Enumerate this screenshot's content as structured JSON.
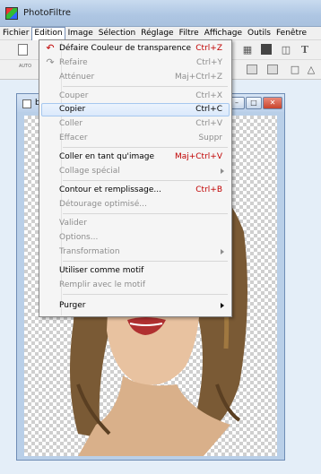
{
  "app": {
    "title": "PhotoFiltre"
  },
  "menubar": [
    "Fichier",
    "Edition",
    "Image",
    "Sélection",
    "Réglage",
    "Filtre",
    "Affichage",
    "Outils",
    "Fenêtre"
  ],
  "toolbar": {
    "small_label": "AUTO"
  },
  "docwin": {
    "title": "b"
  },
  "menu": {
    "items": [
      {
        "label": "Défaire Couleur de transparence",
        "shortcut": "Ctrl+Z",
        "enabled": true,
        "icon": "undo-icon"
      },
      {
        "label": "Refaire",
        "shortcut": "Ctrl+Y",
        "enabled": false,
        "icon": "redo-icon"
      },
      {
        "label": "Atténuer",
        "shortcut": "Maj+Ctrl+Z",
        "enabled": false
      },
      {
        "label": "Couper",
        "shortcut": "Ctrl+X",
        "enabled": false
      },
      {
        "label": "Copier",
        "shortcut": "Ctrl+C",
        "enabled": true,
        "highlighted": true
      },
      {
        "label": "Coller",
        "shortcut": "Ctrl+V",
        "enabled": false
      },
      {
        "label": "Effacer",
        "shortcut": "Suppr",
        "enabled": false
      },
      {
        "label": "Coller en tant qu'image",
        "shortcut": "Maj+Ctrl+V",
        "enabled": true
      },
      {
        "label": "Collage spécial",
        "shortcut": "",
        "enabled": false,
        "submenu": true
      },
      {
        "label": "Contour et remplissage...",
        "shortcut": "Ctrl+B",
        "enabled": true
      },
      {
        "label": "Détourage optimisé...",
        "shortcut": "",
        "enabled": false
      },
      {
        "label": "Valider",
        "shortcut": "",
        "enabled": false
      },
      {
        "label": "Options...",
        "shortcut": "",
        "enabled": false
      },
      {
        "label": "Transformation",
        "shortcut": "",
        "enabled": false,
        "submenu": true
      },
      {
        "label": "Utiliser comme motif",
        "shortcut": "",
        "enabled": true
      },
      {
        "label": "Remplir avec le motif",
        "shortcut": "",
        "enabled": false
      },
      {
        "label": "Purger",
        "shortcut": "",
        "enabled": true,
        "submenu": true
      }
    ]
  },
  "colors": {
    "shortcut_red": "#c00000",
    "disabled": "#8d8d8d",
    "highlight_border": "#a6c8ef"
  }
}
